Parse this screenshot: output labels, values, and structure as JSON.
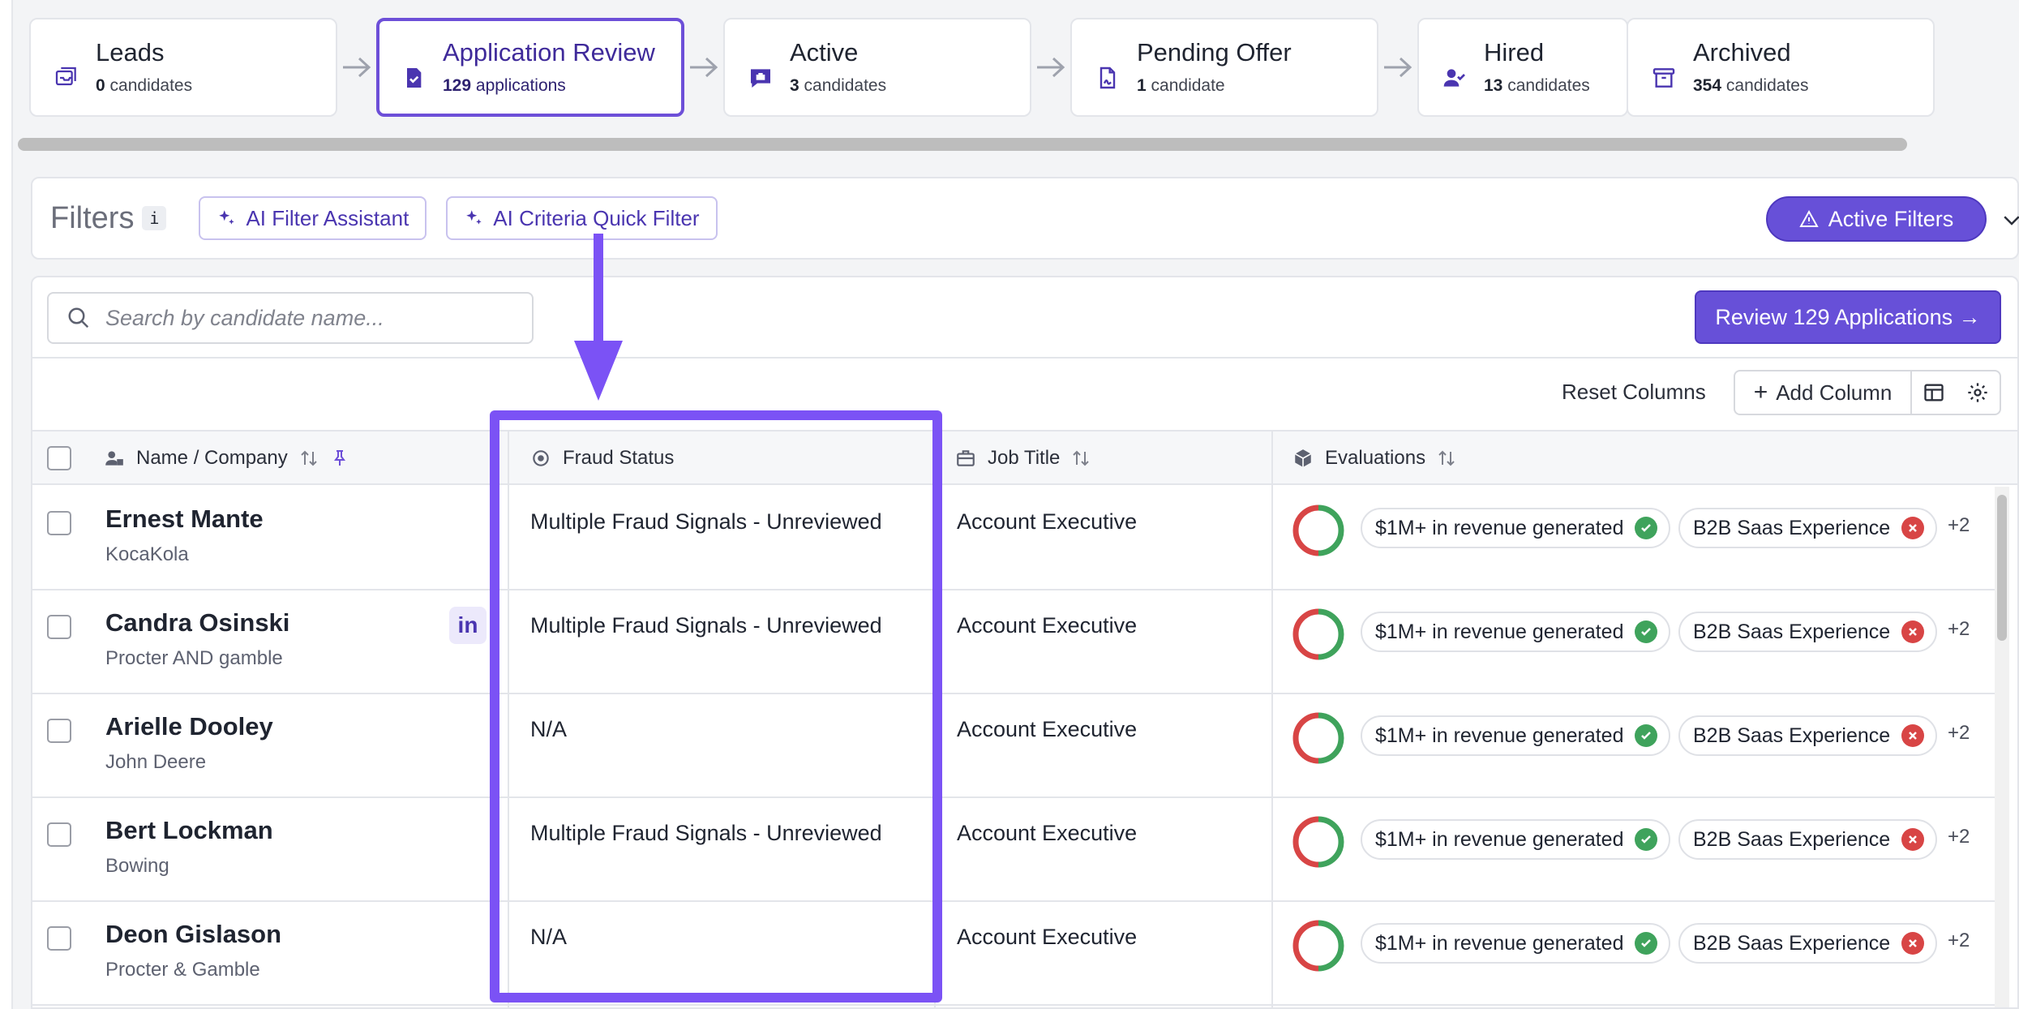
{
  "pipeline": {
    "stages": [
      {
        "title": "Leads",
        "count": "0",
        "unit": "candidates"
      },
      {
        "title": "Application Review",
        "count": "129",
        "unit": "applications"
      },
      {
        "title": "Active",
        "count": "3",
        "unit": "candidates"
      },
      {
        "title": "Pending Offer",
        "count": "1",
        "unit": "candidate"
      },
      {
        "title": "Hired",
        "count": "13",
        "unit": "candidates"
      },
      {
        "title": "Archived",
        "count": "354",
        "unit": "candidates"
      }
    ]
  },
  "filters": {
    "label": "Filters",
    "info": "i",
    "ai_assistant": "AI Filter Assistant",
    "ai_criteria": "AI Criteria Quick Filter",
    "active_filters": "Active Filters"
  },
  "toolbar": {
    "search_placeholder": "Search by candidate name...",
    "review_button": "Review 129 Applications →",
    "reset_columns": "Reset Columns",
    "add_column": "Add Column"
  },
  "table": {
    "columns": {
      "name": "Name / Company",
      "fraud": "Fraud Status",
      "job": "Job Title",
      "evaluations": "Evaluations"
    },
    "rows": [
      {
        "name": "Ernest Mante",
        "company": "KocaKola",
        "fraud": "Multiple Fraud Signals - Unreviewed",
        "job": "Account Executive",
        "eval_pass": "$1M+ in revenue generated",
        "eval_fail": "B2B Saas Experience",
        "more": "+2",
        "linkedin": ""
      },
      {
        "name": "Candra Osinski",
        "company": "Procter AND gamble",
        "fraud": "Multiple Fraud Signals - Unreviewed",
        "job": "Account Executive",
        "eval_pass": "$1M+ in revenue generated",
        "eval_fail": "B2B Saas Experience",
        "more": "+2",
        "linkedin": "in"
      },
      {
        "name": "Arielle Dooley",
        "company": "John Deere",
        "fraud": "N/A",
        "job": "Account Executive",
        "eval_pass": "$1M+ in revenue generated",
        "eval_fail": "B2B Saas Experience",
        "more": "+2",
        "linkedin": ""
      },
      {
        "name": "Bert Lockman",
        "company": "Bowing",
        "fraud": "Multiple Fraud Signals - Unreviewed",
        "job": "Account Executive",
        "eval_pass": "$1M+ in revenue generated",
        "eval_fail": "B2B Saas Experience",
        "more": "+2",
        "linkedin": ""
      },
      {
        "name": "Deon Gislason",
        "company": "Procter & Gamble",
        "fraud": "N/A",
        "job": "Account Executive",
        "eval_pass": "$1M+ in revenue generated",
        "eval_fail": "B2B Saas Experience",
        "more": "+2",
        "linkedin": ""
      }
    ]
  },
  "colors": {
    "accent": "#6750d8",
    "annotation": "#7b52f5",
    "pass": "#3fa35c",
    "fail": "#d84545"
  }
}
